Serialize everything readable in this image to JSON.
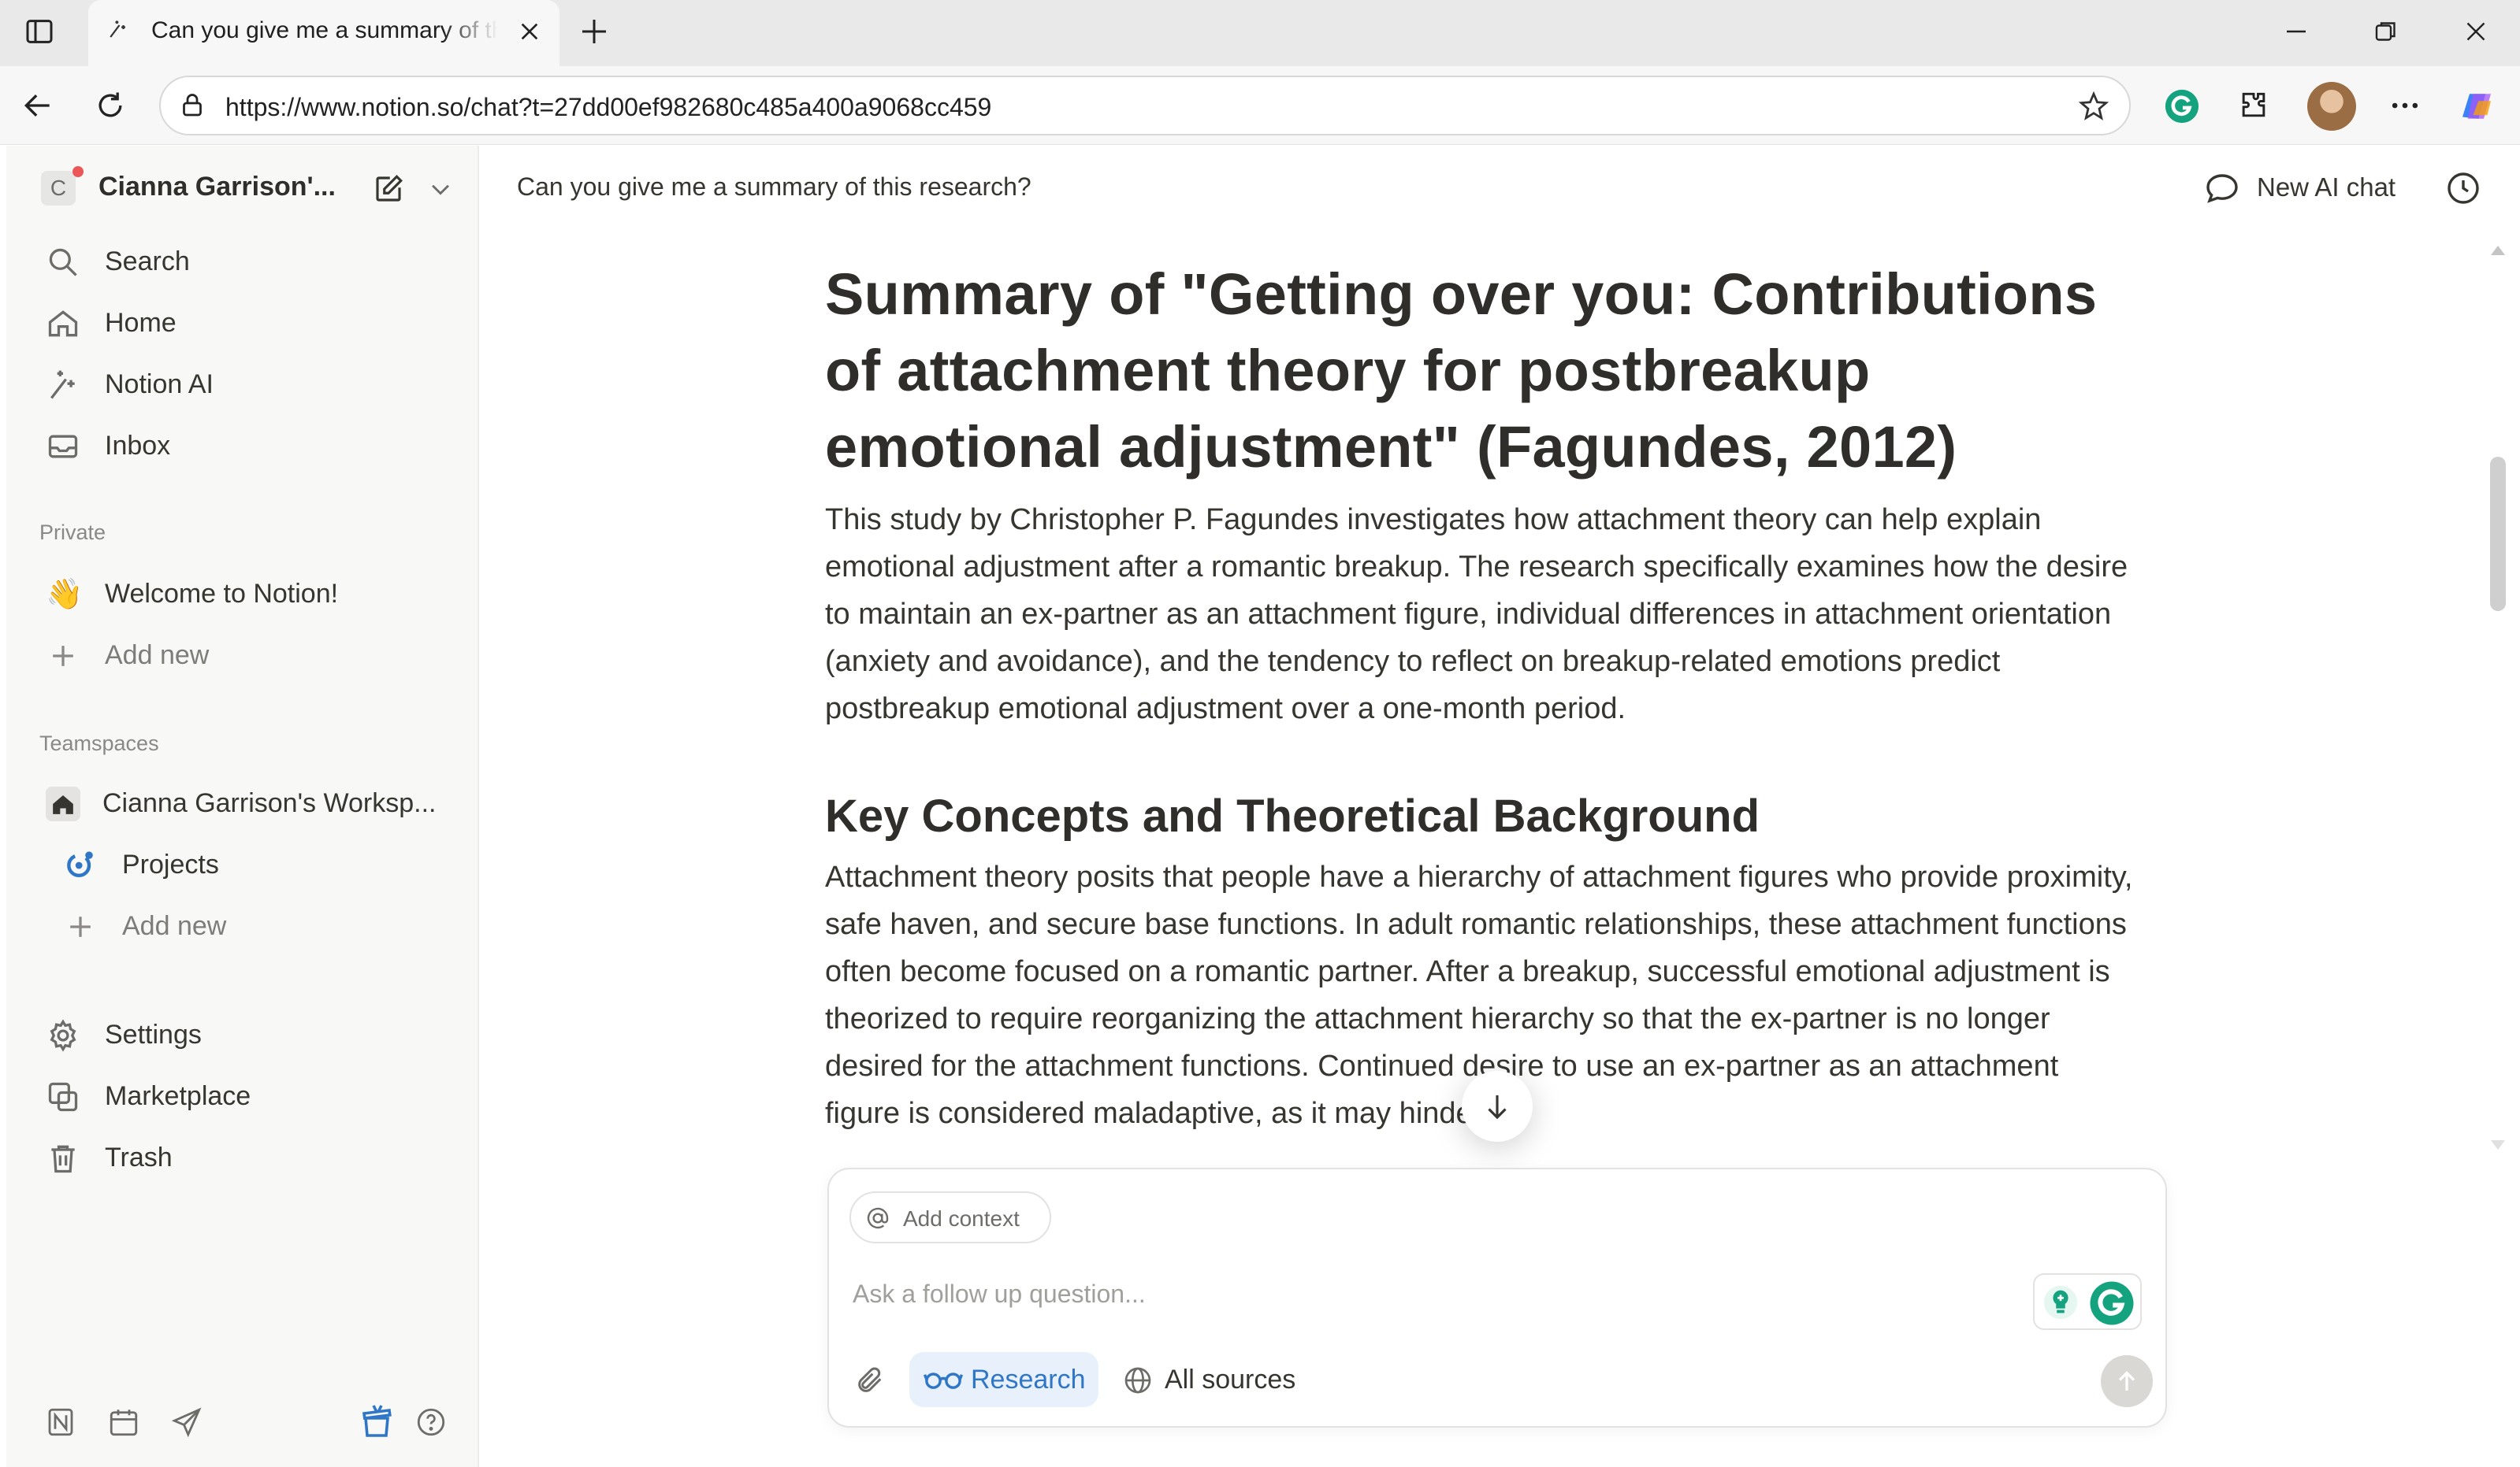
{
  "browser": {
    "tab_title": "Can you give me a summary of this research?",
    "url": "https://www.notion.so/chat?t=27dd00ef982680c485a400a9068cc459"
  },
  "sidebar": {
    "workspace_initial": "C",
    "workspace_name": "Cianna Garrison'...",
    "nav": [
      {
        "label": "Search",
        "icon": "search-icon"
      },
      {
        "label": "Home",
        "icon": "home-icon"
      },
      {
        "label": "Notion AI",
        "icon": "notion-ai-icon"
      },
      {
        "label": "Inbox",
        "icon": "inbox-icon"
      }
    ],
    "private_label": "Private",
    "private_pages": [
      {
        "label": "Welcome to Notion!",
        "icon": "waving-hand-icon"
      },
      {
        "label": "Add new",
        "icon": "plus-icon"
      }
    ],
    "teamspaces_label": "Teamspaces",
    "teamspace_name": "Cianna Garrison's Worksp...",
    "teamspace_pages": [
      {
        "label": "Projects",
        "icon": "projects-icon"
      },
      {
        "label": "Add new",
        "icon": "plus-icon"
      }
    ],
    "footer_nav": [
      {
        "label": "Settings",
        "icon": "gear-icon"
      },
      {
        "label": "Marketplace",
        "icon": "marketplace-icon"
      },
      {
        "label": "Trash",
        "icon": "trash-icon"
      }
    ]
  },
  "header": {
    "chat_title": "Can you give me a summary of this research?",
    "new_chat_label": "New AI chat"
  },
  "document": {
    "title": "Summary of \"Getting over you: Contributions of attachment theory for postbreakup emotional adjustment\" (Fagundes, 2012)",
    "intro": "This study by Christopher P. Fagundes investigates how attachment theory can help explain emotional adjustment after a romantic breakup. The research specifically examines how the desire to maintain an ex-partner as an attachment figure, individual differences in attachment orientation (anxiety and avoidance), and the tendency to reflect on breakup-related emotions predict postbreakup emotional adjustment over a one-month period.",
    "section_heading": "Key Concepts and Theoretical Background",
    "section_body": "Attachment theory posits that people have a hierarchy of attachment figures who provide proximity, safe haven, and secure base functions. In adult romantic relationships, these attachment functions often become focused on a romantic partner. After a breakup, successful emotional adjustment is theorized to require reorganizing the attachment hierarchy so that the ex-partner is no longer desired for the attachment functions. Continued desire to use an ex-partner as an attachment figure is considered maladaptive, as it may hinder"
  },
  "composer": {
    "context_label": "Add context",
    "placeholder": "Ask a follow up question...",
    "research_label": "Research",
    "sources_label": "All sources"
  },
  "colors": {
    "accent_blue": "#2f77c6",
    "sidebar_bg": "#f8f8f7"
  }
}
